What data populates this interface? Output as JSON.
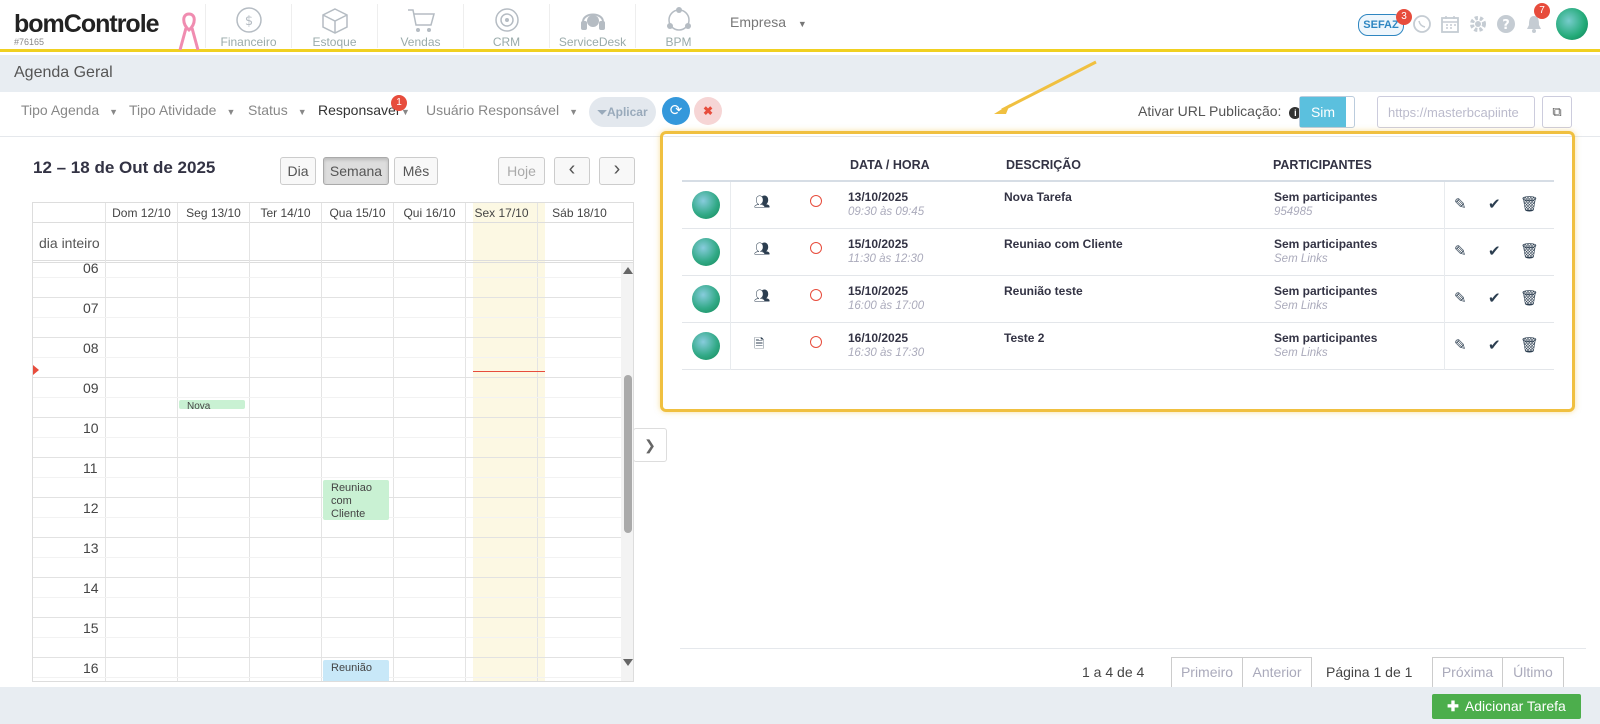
{
  "brand": {
    "logo": "bomControle",
    "account_id": "#76165"
  },
  "nav_modules": [
    {
      "label": "Financeiro",
      "icon": "dollar-icon"
    },
    {
      "label": "Estoque",
      "icon": "box-icon"
    },
    {
      "label": "Vendas",
      "icon": "cart-icon"
    },
    {
      "label": "CRM",
      "icon": "target-icon"
    },
    {
      "label": "ServiceDesk",
      "icon": "headset-icon"
    },
    {
      "label": "BPM",
      "icon": "network-icon"
    }
  ],
  "company_menu": {
    "label": "Empresa"
  },
  "header_right": {
    "sefaz_label": "SEFAZ",
    "sefaz_badge": "3",
    "notifications_badge": "7"
  },
  "page": {
    "title": "Agenda Geral"
  },
  "filters": {
    "tipo_agenda": "Tipo Agenda",
    "tipo_atividade": "Tipo Atividade",
    "status": "Status",
    "responsavel": "Responsavel",
    "responsavel_badge": "1",
    "usuario_responsavel": "Usuário Responsável",
    "apply_label": "Aplicar"
  },
  "publication": {
    "label": "Ativar URL Publicação:",
    "toggle_label": "Sim",
    "url_value": "https://masterbcapiinte"
  },
  "calendar": {
    "range_title": "12 – 18 de Out de 2025",
    "view_day": "Dia",
    "view_week": "Semana",
    "view_month": "Mês",
    "today_label": "Hoje",
    "prev_icon": "‹",
    "next_icon": "›",
    "all_day_label": "dia inteiro",
    "days": [
      "Dom 12/10",
      "Seg 13/10",
      "Ter 14/10",
      "Qua 15/10",
      "Qui 16/10",
      "Sex 17/10",
      "Sáb 18/10"
    ],
    "hours": [
      "06",
      "07",
      "08",
      "09",
      "10",
      "11",
      "12",
      "13",
      "14",
      "15",
      "16"
    ],
    "events": [
      {
        "title": "Nova Tarefa",
        "day": "Seg 13/10"
      },
      {
        "title": "Reuniao com Cliente",
        "day": "Qua 15/10"
      },
      {
        "title": "Reunião",
        "day": "Qua 15/10"
      }
    ]
  },
  "task_table": {
    "headers": {
      "date": "DATA / HORA",
      "description": "DESCRIÇÃO",
      "participants": "PARTICIPANTES"
    },
    "rows": [
      {
        "type_icon": "users-icon",
        "date": "13/10/2025",
        "time": "09:30 às 09:45",
        "description": "Nova Tarefa",
        "participants": "Sem participantes",
        "sub": "954985"
      },
      {
        "type_icon": "users-icon",
        "date": "15/10/2025",
        "time": "11:30 às 12:30",
        "description": "Reuniao com Cliente",
        "participants": "Sem participantes",
        "sub": "Sem Links"
      },
      {
        "type_icon": "users-icon",
        "date": "15/10/2025",
        "time": "16:00 às 17:00",
        "description": "Reunião teste",
        "participants": "Sem participantes",
        "sub": "Sem Links"
      },
      {
        "type_icon": "document-icon",
        "date": "16/10/2025",
        "time": "16:30 às 17:30",
        "description": "Teste 2",
        "participants": "Sem participantes",
        "sub": "Sem Links"
      }
    ]
  },
  "pagination": {
    "count": "1 a 4 de 4",
    "first": "Primeiro",
    "prev": "Anterior",
    "page_info": "Página 1 de 1",
    "next": "Próxima",
    "last": "Último"
  },
  "footer": {
    "add_task": "Adicionar Tarefa"
  },
  "colors": {
    "accent": "#f0c040",
    "primary": "#3498db",
    "success": "#4cae4c",
    "danger": "#e74c3c"
  }
}
